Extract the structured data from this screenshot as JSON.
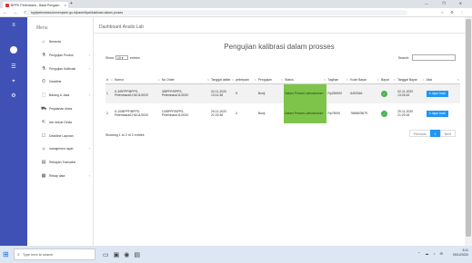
{
  "browser": {
    "tab_title": "BPFK Pelembara - Balai Pengam",
    "tab_close": "×",
    "new_tab": "+",
    "window_controls": "— ❐ ✕",
    "url": "bppfpelembara.kemenperin.go.id/panel/bpsi/kalibrasi-dalam-proses",
    "nav_buttons": "← → ⟳",
    "ext_icons": "☆ ⚙ ⋮"
  },
  "sidebar": {
    "title": "Menu",
    "items": [
      {
        "label": "Beranda",
        "icon": "home-icon",
        "glyph": "⌂",
        "has_children": false
      },
      {
        "label": "Pengujian Produk",
        "icon": "flask-icon",
        "glyph": "⚗",
        "has_children": true
      },
      {
        "label": "Pengujian Kalibrasi",
        "icon": "flask-icon",
        "glyph": "⚗",
        "has_children": true
      },
      {
        "label": "Deadline",
        "icon": "clock-icon",
        "glyph": "⏱",
        "has_children": false
      },
      {
        "label": "Barang & Jasa",
        "icon": "box-icon",
        "glyph": "⬚",
        "has_children": true
      },
      {
        "label": "Perjalanan dinas",
        "icon": "car-icon",
        "glyph": "⛟",
        "has_children": false
      },
      {
        "label": "Izin keluar Dinas",
        "icon": "exit-icon",
        "glyph": "⇱",
        "has_children": false
      },
      {
        "label": "Deadline Laporan",
        "icon": "calendar-icon",
        "glyph": "☐",
        "has_children": false
      },
      {
        "label": "manajemen rapat",
        "icon": "people-icon",
        "glyph": "☺",
        "has_children": true
      },
      {
        "label": "Rekapan Transaksi",
        "icon": "list-icon",
        "glyph": "▤",
        "has_children": false
      },
      {
        "label": "Rekap data",
        "icon": "chart-icon",
        "glyph": "▦",
        "has_children": true
      }
    ],
    "chevron": "›"
  },
  "strip_icons": [
    "menu-icon",
    "avatar-icon",
    "list-icon",
    "location-icon",
    "settings-icon"
  ],
  "header": {
    "title": "Dashboard Analis Lab"
  },
  "main": {
    "page_title": "Pengujian kalibrasi dalam prosses",
    "show_label": "Show",
    "entries_value": "10",
    "entries_label": "entries",
    "search_label": "Search:",
    "search_placeholder": "",
    "columns": [
      "#",
      "Nomor",
      "No Order",
      "Tanggal daftar",
      "pekerjaan",
      "Pengujian",
      "Status",
      "Tagihan",
      "Kode Bayar",
      "Bayar",
      "Tanggal Bayar",
      "Aksi"
    ],
    "rows": [
      {
        "num": "1",
        "nomor": "K-3/BPPF/BPPS-Pelembara/LHU/11/2020",
        "order": "3/BPPF/BPPS-Pelembara/11/2020",
        "tanggal": "02-11-2020 13:14:38",
        "pekerjaan": "5",
        "pengujian": "Bunji",
        "status": "Dalam Proses Laboratorium",
        "tagihan": "Rp250000",
        "kode": "6453346",
        "bayar": "✓",
        "tgl_bayar": "02-11-2020 13:26:45",
        "aksi": "lapor hasil"
      },
      {
        "num": "2",
        "nomor": "K-10/BPPF/BPPS-Pelembara/LHU/11/2020",
        "order": "10/BPPF/BPPS-Pelembara/11/2020",
        "tanggal": "29-11-2020 21:23:38",
        "pekerjaan": "4",
        "pengujian": "Bunji",
        "status": "Dalam Proses Laboratorium",
        "tagihan": "Rp75000",
        "kode": "7886878679",
        "bayar": "✓",
        "tgl_bayar": "29-11-2020 21:29:18",
        "aksi": "lapor hasil"
      }
    ],
    "info": "Showing 1 to 2 of 2 entries",
    "pager": {
      "prev": "Previous",
      "page": "1",
      "next": "Next"
    }
  },
  "taskbar": {
    "search_placeholder": "Type here to search",
    "search_glyph": "⌕",
    "time": "8:11",
    "date": "09/12/2020",
    "tray_icons": "⌃ ☁ ♪ ✉"
  }
}
